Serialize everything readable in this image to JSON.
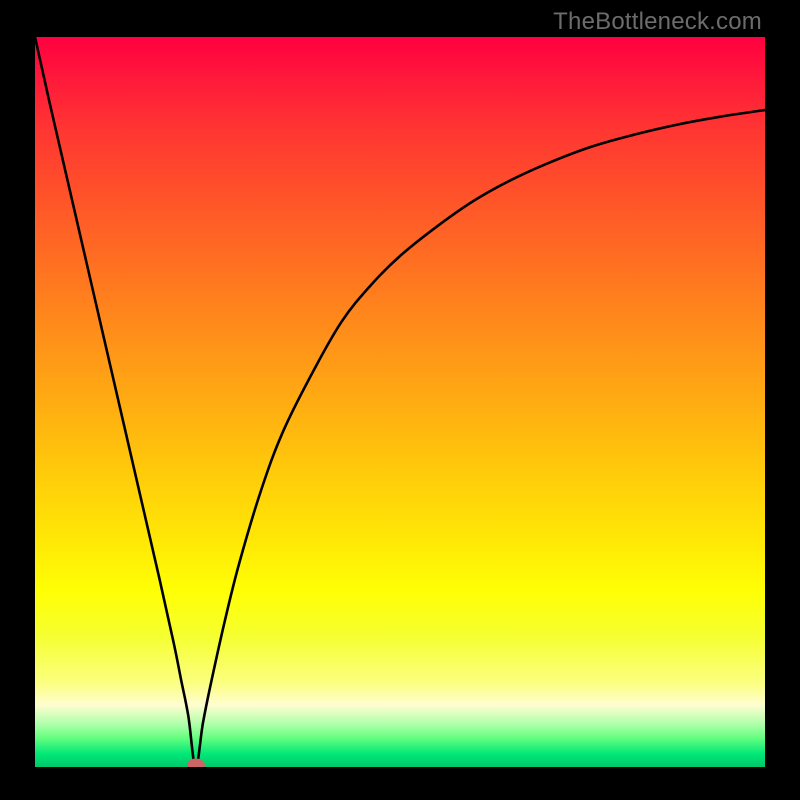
{
  "watermark": "TheBottleneck.com",
  "chart_data": {
    "type": "line",
    "title": "",
    "xlabel": "",
    "ylabel": "",
    "xlim": [
      0,
      100
    ],
    "ylim": [
      0,
      100
    ],
    "grid": false,
    "marker": {
      "x": 22,
      "y": 0,
      "color": "#cc6666"
    },
    "series": [
      {
        "name": "curve",
        "x": [
          0,
          2,
          5,
          8,
          11,
          14,
          17,
          19,
          20,
          21,
          22,
          23,
          24,
          26,
          28,
          31,
          34,
          38,
          42,
          46,
          50,
          55,
          60,
          65,
          70,
          76,
          82,
          88,
          94,
          100
        ],
        "y": [
          100,
          91,
          78,
          65,
          52,
          39,
          26,
          17,
          12,
          7,
          0,
          6,
          11,
          20,
          28,
          38,
          46,
          54,
          61,
          66,
          70,
          74,
          77.5,
          80.3,
          82.6,
          84.9,
          86.6,
          88.0,
          89.1,
          90.0
        ]
      }
    ],
    "gradient_stops": [
      {
        "pos": 0.0,
        "color": "#ff0040"
      },
      {
        "pos": 0.15,
        "color": "#ff4020"
      },
      {
        "pos": 0.35,
        "color": "#ff8010"
      },
      {
        "pos": 0.55,
        "color": "#ffc008"
      },
      {
        "pos": 0.75,
        "color": "#ffff10"
      },
      {
        "pos": 0.9,
        "color": "#fdffc0"
      },
      {
        "pos": 0.96,
        "color": "#66ff80"
      },
      {
        "pos": 1.0,
        "color": "#00c86a"
      }
    ]
  }
}
